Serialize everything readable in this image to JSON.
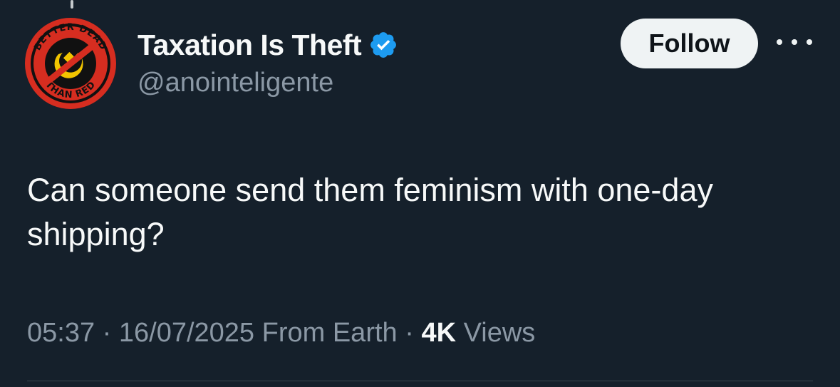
{
  "author": {
    "display_name": "Taxation Is Theft",
    "handle": "@anointeligente",
    "verified": true,
    "avatar": {
      "icon": "anti-communist-badge-icon",
      "top_text": "BETTER DEAD",
      "bottom_text": "THAN RED"
    }
  },
  "actions": {
    "follow_label": "Follow",
    "more_icon": "more-options-icon"
  },
  "tweet": {
    "text": "Can someone send them feminism with one-day shipping?"
  },
  "meta": {
    "time": "05:37",
    "date": "16/07/2025",
    "source": "From Earth",
    "separator": "·",
    "views_count": "4K",
    "views_label": "Views"
  },
  "colors": {
    "background": "#15202b",
    "text_primary": "#f7f9f9",
    "text_secondary": "#8b98a5",
    "verified_blue": "#1d9bf0",
    "avatar_red": "#d62d20"
  }
}
